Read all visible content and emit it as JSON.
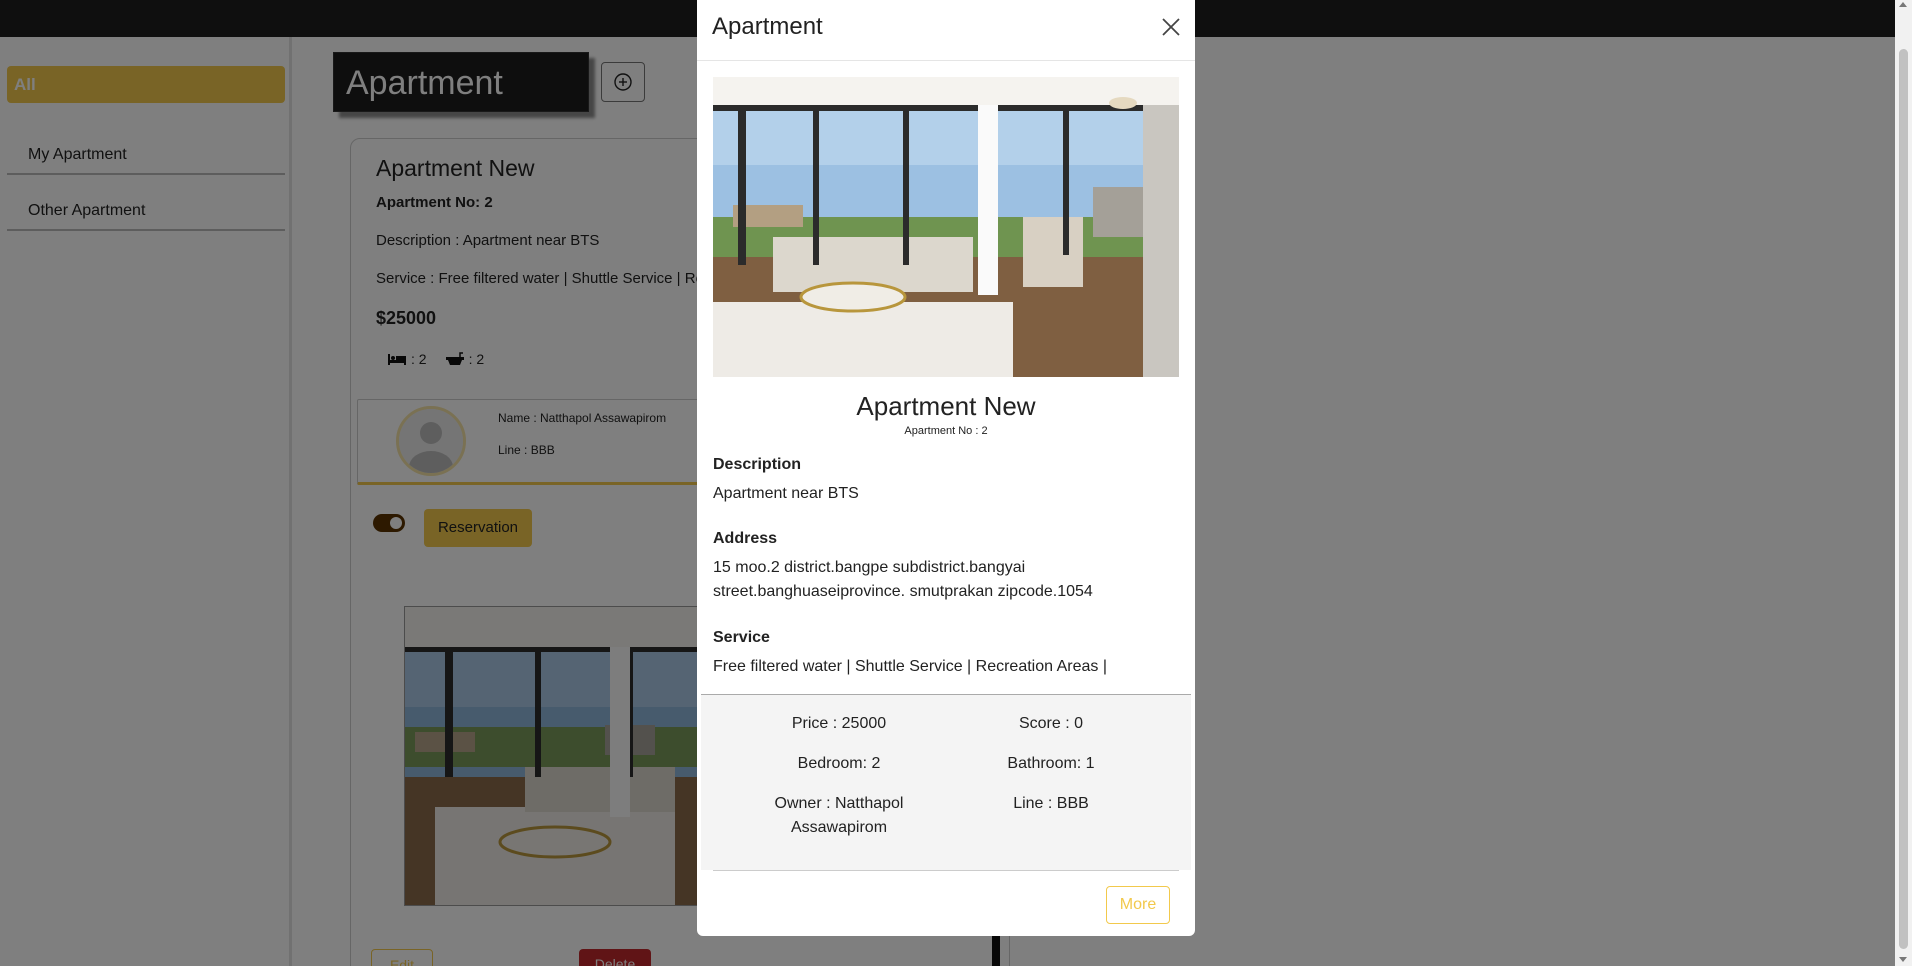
{
  "sidebar": {
    "items": [
      {
        "label": "All"
      },
      {
        "label": "My Apartment"
      },
      {
        "label": "Other Apartment"
      }
    ]
  },
  "page": {
    "title": "Apartment"
  },
  "card": {
    "title": "Apartment New",
    "number": "Apartment No: 2",
    "description": "Description : Apartment near BTS",
    "service": "Service : Free filtered water | Shuttle Service | Recreation Areas |",
    "price": "$25000",
    "bedrooms": ": 2",
    "bathrooms": ": 2",
    "owner_name": "Name : Natthapol Assawapirom",
    "owner_line": "Line : BBB",
    "reservation_label": "Reservation",
    "edit_label": "Edit",
    "delete_label": "Delete"
  },
  "modal": {
    "header_title": "Apartment",
    "title": "Apartment New",
    "number": "Apartment No : 2",
    "description_label": "Description",
    "description": "Apartment near BTS",
    "address_label": "Address",
    "address_line1": "15 moo.2 district.bangpe subdistrict.bangyai",
    "address_line2": "street.banghuaseiprovince. smutprakan zipcode.1054",
    "service_label": "Service",
    "service": "Free filtered water | Shuttle Service | Recreation Areas |",
    "stats": {
      "price": "Price : 25000",
      "score": "Score : 0",
      "bedroom": "Bedroom: 2",
      "bathroom": "Bathroom: 1",
      "owner_line1": "Owner : Natthapol",
      "owner_line2": "Assawapirom",
      "line": "Line : BBB"
    },
    "more_label": "More"
  },
  "colors": {
    "accent": "#f2c94c",
    "danger": "#c0282d",
    "topbar": "#1e1e1e"
  }
}
